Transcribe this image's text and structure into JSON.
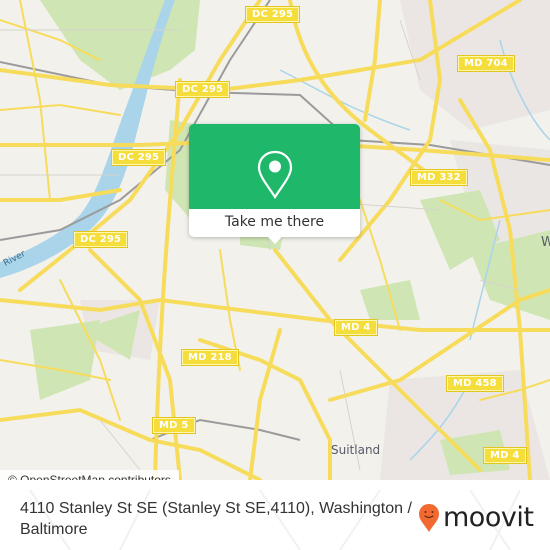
{
  "map": {
    "attribution": "© OpenStreetMap contributors",
    "road_shields": [
      {
        "id": "dc295-top",
        "label": "DC 295"
      },
      {
        "id": "dc295-upper",
        "label": "DC 295"
      },
      {
        "id": "dc295-mid",
        "label": "DC 295"
      },
      {
        "id": "dc295-lower",
        "label": "DC 295"
      },
      {
        "id": "md704",
        "label": "MD 704"
      },
      {
        "id": "md332",
        "label": "MD 332"
      },
      {
        "id": "md4-mid",
        "label": "MD 4"
      },
      {
        "id": "md218",
        "label": "MD 218"
      },
      {
        "id": "md458",
        "label": "MD 458"
      },
      {
        "id": "md5",
        "label": "MD 5"
      },
      {
        "id": "md4-lower",
        "label": "MD 4"
      }
    ],
    "place_labels": {
      "suitland": "Suitland",
      "edge_w": "W",
      "river": "River"
    },
    "colors": {
      "land": "#f2f1ec",
      "park": "#c8e6a8",
      "water": "#a9d4ea",
      "road": "#f7dc5c",
      "urban": "#e8e2df"
    }
  },
  "popup": {
    "icon": "map-pin-icon",
    "button_label": "Take me there",
    "accent": "#1fb86a"
  },
  "footer": {
    "address": "4110 Stanley St SE (Stanley St SE,4110), Washington / Baltimore",
    "brand": "moovit",
    "brand_icon": "moovit-smiley-pin-icon",
    "brand_color": "#f26a32"
  }
}
